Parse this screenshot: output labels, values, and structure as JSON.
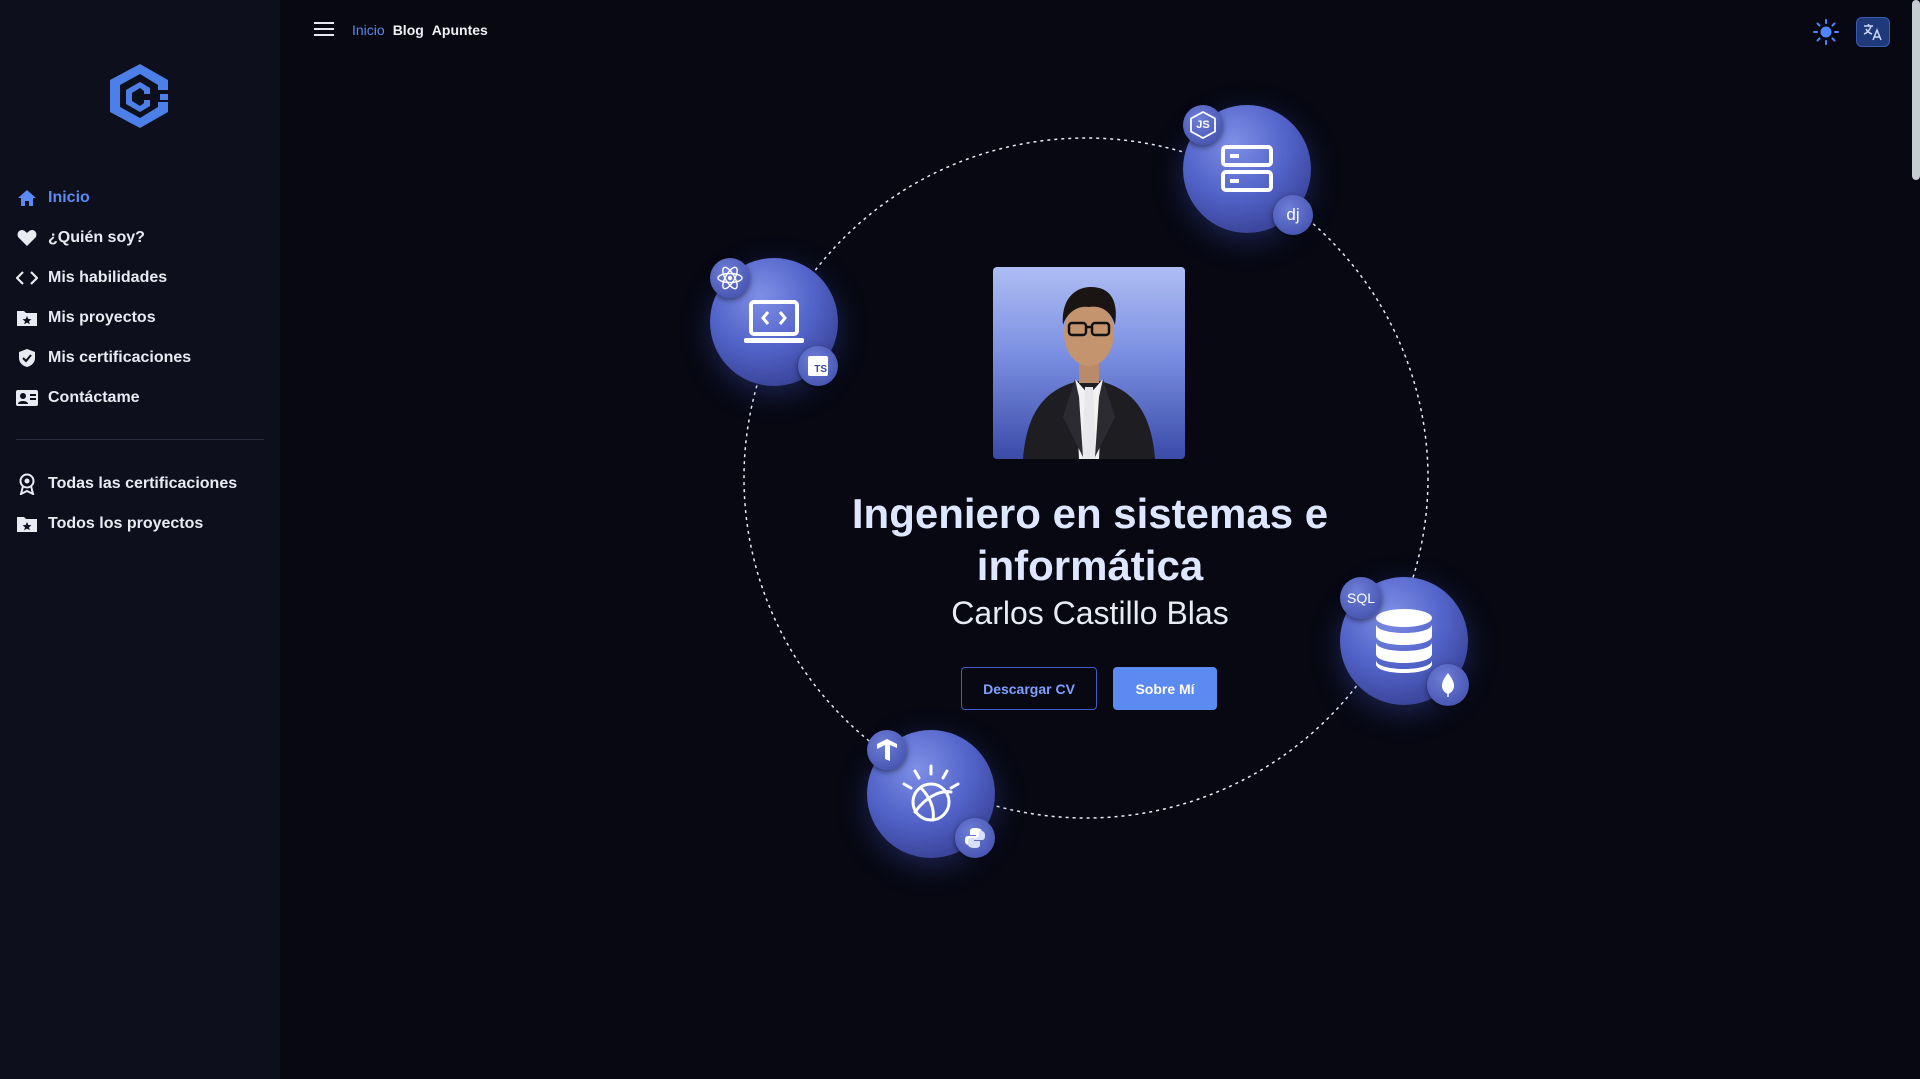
{
  "sidebar": {
    "logo": "cc-logo-icon",
    "items": [
      {
        "label": "Inicio",
        "icon": "home-icon",
        "active": true
      },
      {
        "label": "¿Quién soy?",
        "icon": "heart-icon"
      },
      {
        "label": "Mis habilidades",
        "icon": "code-icon"
      },
      {
        "label": "Mis proyectos",
        "icon": "folder-star-icon"
      },
      {
        "label": "Mis certificaciones",
        "icon": "shield-check-icon"
      },
      {
        "label": "Contáctame",
        "icon": "contact-card-icon"
      }
    ],
    "secondary_items": [
      {
        "label": "Todas las certificaciones",
        "icon": "award-icon"
      },
      {
        "label": "Todos los proyectos",
        "icon": "folder-star-icon"
      }
    ]
  },
  "topbar": {
    "links": [
      {
        "label": "Inicio",
        "active": true
      },
      {
        "label": "Blog"
      },
      {
        "label": "Apuntes"
      }
    ],
    "theme_icon": "sun-icon",
    "language_icon": "translate-icon"
  },
  "hero": {
    "title": "Ingeniero en sistemas e informática",
    "name": "Carlos Castillo Blas",
    "download_cv_label": "Descargar CV",
    "about_label": "Sobre Mí"
  },
  "tech_bubbles": {
    "server": {
      "icon": "server-icon",
      "badges": [
        "nodejs-icon",
        "django-icon"
      ],
      "badge_text": {
        "js": "JS",
        "dj": "dj"
      }
    },
    "frontend": {
      "icon": "laptop-code-icon",
      "badges": [
        "react-icon",
        "typescript-icon"
      ],
      "badge_text": {
        "ts": "TS"
      }
    },
    "database": {
      "icon": "database-icon",
      "badges": [
        "sql-icon",
        "mongodb-icon"
      ],
      "badge_text": {
        "sql": "SQL"
      }
    },
    "ai": {
      "icon": "ibm-watson-icon",
      "badges": [
        "tensorflow-icon",
        "python-icon"
      ]
    }
  },
  "colors": {
    "accent": "#5b8af0",
    "background": "#070812",
    "sidebar": "#0d0f1c"
  }
}
